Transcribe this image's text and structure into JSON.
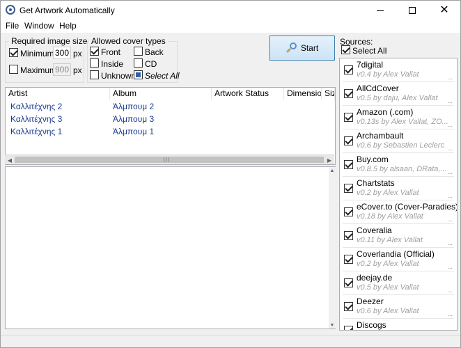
{
  "window": {
    "title": "Get Artwork Automatically"
  },
  "menu": {
    "file": "File",
    "window": "Window",
    "help": "Help"
  },
  "size_group": {
    "title": "Required image size",
    "minimum_label": "Minimum",
    "minimum_value": "300",
    "minimum_unit": "px",
    "minimum_checked": true,
    "maximum_label": "Maximum",
    "maximum_value": "900",
    "maximum_unit": "px",
    "maximum_checked": false
  },
  "cover_types": {
    "title": "Allowed cover types",
    "front": "Front",
    "inside": "Inside",
    "unknown": "Unknown",
    "back": "Back",
    "cd": "CD",
    "select_all": "Select All"
  },
  "start_button": "Start",
  "results": {
    "headers": [
      "Artist",
      "Album",
      "Artwork Status",
      "Dimensions",
      "Size"
    ],
    "rows": [
      {
        "artist": "Καλλιτέχνης 2",
        "album": "Άλμπουμ 2"
      },
      {
        "artist": "Καλλιτέχνης 3",
        "album": "Άλμπουμ 3"
      },
      {
        "artist": "Καλλιτέχνης 1",
        "album": "Άλμπουμ 1"
      }
    ]
  },
  "sources": {
    "label": "Sources:",
    "select_all": "Select All",
    "items": [
      {
        "name": "7digital",
        "version": "v0.4 by Alex Vallat"
      },
      {
        "name": "AllCdCover",
        "version": "v0.5 by daju, Alex Vallat"
      },
      {
        "name": "Amazon (.com)",
        "version": "v0.13s by Alex Vallat, ZO..."
      },
      {
        "name": "Archambault",
        "version": "v0.6 by Sebastien Leclerc"
      },
      {
        "name": "Buy.com",
        "version": "v0.8.5 by alsaan, DRata,..."
      },
      {
        "name": "Chartstats",
        "version": "v0.2 by Alex Vallat"
      },
      {
        "name": "eCover.to (Cover-Paradies)",
        "version": "v0.18 by Alex Vallat"
      },
      {
        "name": "Coveralia",
        "version": "v0.11 by Alex Vallat"
      },
      {
        "name": "Coverlandia (Official)",
        "version": "v0.2 by Alex Vallat"
      },
      {
        "name": "deejay.de",
        "version": "v0.5 by Alex Vallat"
      },
      {
        "name": "Deezer",
        "version": "v0.6 by Alex Vallat"
      },
      {
        "name": "Discogs",
        "version": ""
      }
    ]
  }
}
